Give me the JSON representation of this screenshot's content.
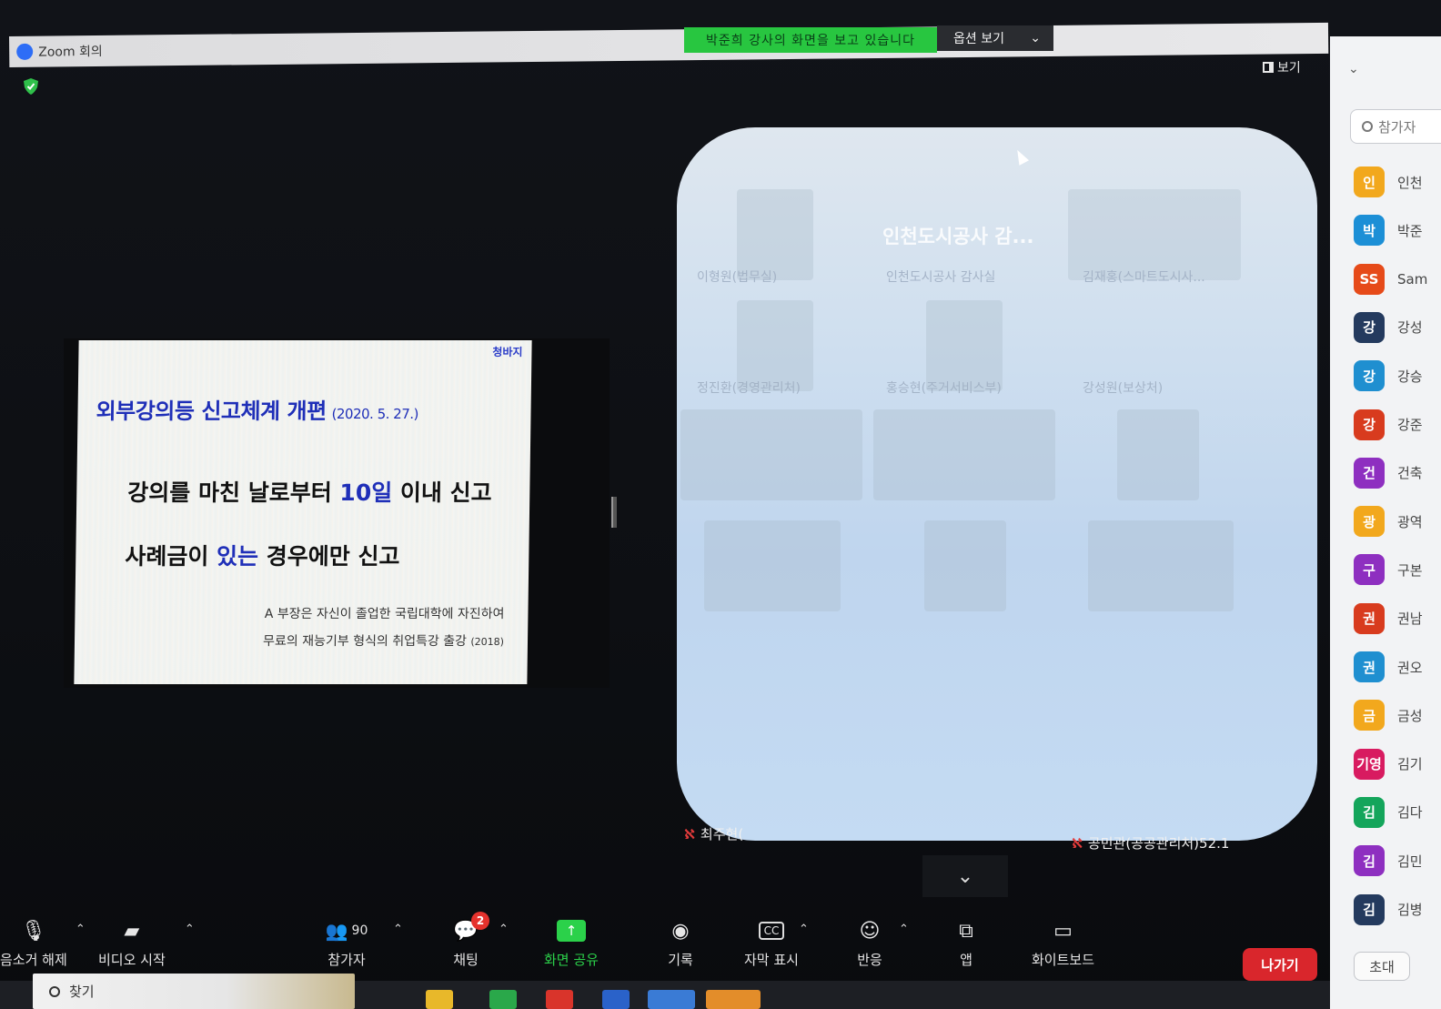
{
  "window": {
    "title": "Zoom 회의"
  },
  "share_banner": {
    "text": "박준희 강사의 화면을 보고 있습니다",
    "options_label": "옵션 보기"
  },
  "view_button": {
    "label": "보기"
  },
  "slide": {
    "tag": "청바지",
    "heading": "외부강의등 신고체계 개편",
    "heading_date": "(2020. 5. 27.)",
    "line1_pre": "강의를 마친 날로부터 ",
    "line1_highlight": "10일",
    "line1_post": " 이내 신고",
    "line2_pre": "사례금이 ",
    "line2_highlight": "있는",
    "line2_post": " 경우에만 신고",
    "note1": "A 부장은 자신이 졸업한 국립대학에 자진하여",
    "note2": "무료의 재능기부 형식의 취업특강 출강",
    "note2_year": "(2018)"
  },
  "gallery": {
    "tiles": [
      {
        "name": "이형원(법무실)"
      },
      {
        "name": "인천도시공사 감사실",
        "big": "인천도시공사 감..."
      },
      {
        "name": "김재홍(스마트도시사..."
      },
      {
        "name": "정진환(경영관리처)"
      },
      {
        "name": "홍승현(주거서비스부)"
      },
      {
        "name": "강성원(보상처)"
      }
    ]
  },
  "bottom_captions": [
    {
      "text": "최주현("
    },
    {
      "text": "공민관(공공관리처)52.1"
    }
  ],
  "sidebar": {
    "search_placeholder": "참가자",
    "invite_label": "초대",
    "participants": [
      {
        "initial": "인",
        "name": "인천",
        "color": "#f2a81d"
      },
      {
        "initial": "박",
        "name": "박준",
        "color": "#1c8fd6"
      },
      {
        "initial": "SS",
        "name": "Sam",
        "color": "#e64a19"
      },
      {
        "initial": "강",
        "name": "강성",
        "color": "#243a5e"
      },
      {
        "initial": "강",
        "name": "강승",
        "color": "#1f8fd0"
      },
      {
        "initial": "강",
        "name": "강준",
        "color": "#d83b1e"
      },
      {
        "initial": "건",
        "name": "건축",
        "color": "#8e2fc0"
      },
      {
        "initial": "광",
        "name": "광역",
        "color": "#f2a81d"
      },
      {
        "initial": "구",
        "name": "구본",
        "color": "#8e2fc0"
      },
      {
        "initial": "권",
        "name": "권남",
        "color": "#d83b1e"
      },
      {
        "initial": "권",
        "name": "권오",
        "color": "#1f8fd0"
      },
      {
        "initial": "금",
        "name": "금성",
        "color": "#f2a81d"
      },
      {
        "initial": "기영",
        "name": "김기",
        "color": "#d81b60"
      },
      {
        "initial": "김",
        "name": "김다",
        "color": "#14a55b"
      },
      {
        "initial": "김",
        "name": "김민",
        "color": "#8e2fc0"
      },
      {
        "initial": "김",
        "name": "김병",
        "color": "#243a5e"
      }
    ]
  },
  "toolbar": {
    "unmute": "음소거 해제",
    "start_video": "비디오 시작",
    "participants": "참가자",
    "participant_count": "90",
    "chat": "채팅",
    "chat_badge": "2",
    "share": "화면 공유",
    "record": "기록",
    "captions": "자막 표시",
    "captions_icon": "CC",
    "reactions": "반응",
    "apps": "앱",
    "whiteboard": "화이트보드",
    "leave": "나가기"
  },
  "taskbar": {
    "search": "찾기"
  }
}
